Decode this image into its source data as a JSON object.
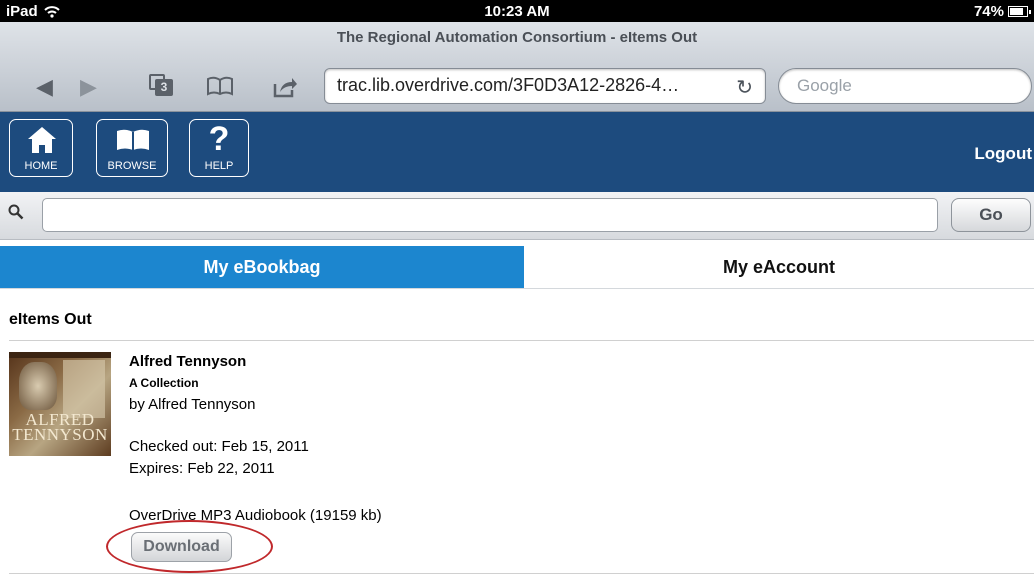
{
  "status_bar": {
    "device": "iPad",
    "time": "10:23 AM",
    "battery": "74%"
  },
  "browser": {
    "page_title": "The Regional Automation Consortium - eItems Out",
    "tab_count": "3",
    "url": "trac.lib.overdrive.com/3F0D3A12-2826-4…",
    "search_placeholder": "Google"
  },
  "header": {
    "home_label": "HOME",
    "browse_label": "BROWSE",
    "help_label": "HELP",
    "help_glyph": "?",
    "logout_label": "Logout",
    "bg_color": "#1d4b7e"
  },
  "search": {
    "value": "",
    "go_label": "Go"
  },
  "tabs": [
    {
      "label": "My eBookbag",
      "active": false
    },
    {
      "label": "My eAccount",
      "active": true
    }
  ],
  "section": {
    "heading": "eItems Out"
  },
  "item": {
    "title": "Alfred Tennyson",
    "subtitle": "A Collection",
    "author": "by Alfred Tennyson",
    "checked_out": "Checked out: Feb 15, 2011",
    "expires": "Expires: Feb 22, 2011",
    "format": "OverDrive MP3 Audiobook (19159 kb)",
    "download_label": "Download",
    "cover_text_line1": "ALFRED",
    "cover_text_line2": "TENNYSON"
  },
  "colors": {
    "tab_inactive": "#1c86cf",
    "highlight": "#c0282b"
  }
}
